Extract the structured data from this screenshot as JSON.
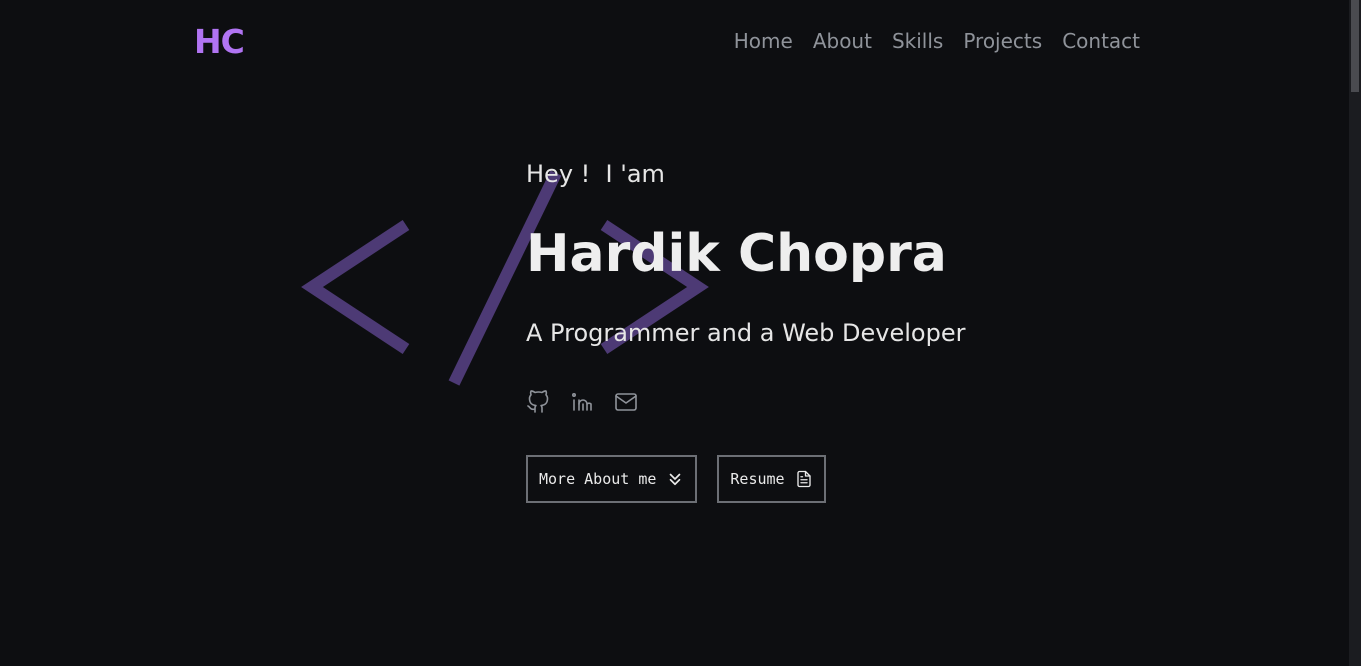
{
  "brand": {
    "logo": "HC",
    "accent": "#b074f2"
  },
  "nav": {
    "items": [
      {
        "label": "Home"
      },
      {
        "label": "About"
      },
      {
        "label": "Skills"
      },
      {
        "label": "Projects"
      },
      {
        "label": "Contact"
      }
    ]
  },
  "hero": {
    "greeting": "Hey !  I 'am",
    "name": "Hardik Chopra",
    "tagline": "A Programmer and a Web Developer",
    "decoration_icon": "code-brackets-icon",
    "decoration_color": "#4d3a75"
  },
  "socials": [
    {
      "icon": "github-icon"
    },
    {
      "icon": "linkedin-icon"
    },
    {
      "icon": "mail-icon"
    }
  ],
  "buttons": {
    "more_about": {
      "label": "More About me",
      "icon": "double-chevron-down-icon"
    },
    "resume": {
      "label": "Resume",
      "icon": "document-icon"
    }
  },
  "colors": {
    "background": "#0d0e11",
    "nav_text": "#8f939a",
    "button_border": "#6c6f75"
  }
}
